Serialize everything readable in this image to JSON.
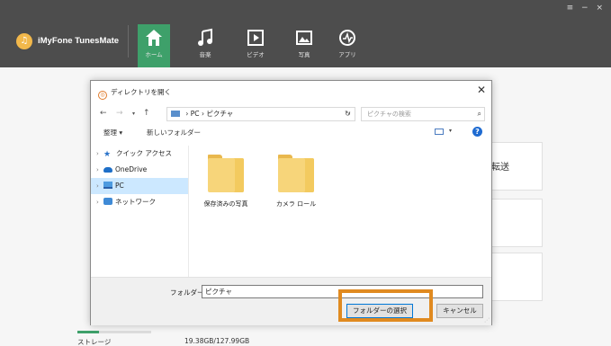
{
  "window_controls": "≡ − ×",
  "app": {
    "name": "iMyFone TunesMate"
  },
  "nav": [
    {
      "label": "ホーム",
      "icon": "home-icon",
      "active": true
    },
    {
      "label": "音楽",
      "icon": "music-icon",
      "active": false
    },
    {
      "label": "ビデオ",
      "icon": "video-icon",
      "active": false
    },
    {
      "label": "写真",
      "icon": "photo-icon",
      "active": false
    },
    {
      "label": "アプリ",
      "icon": "app-icon",
      "active": false
    }
  ],
  "background_card_text": "転送",
  "storage": {
    "label": "ストレージ",
    "value": "19.38GB/127.99GB",
    "used_fraction": 0.15
  },
  "dialog": {
    "title": "ディレクトリを開く",
    "address": [
      "PC",
      "ピクチャ"
    ],
    "search_placeholder": "ピクチャの検索",
    "organize": "整理 ▾",
    "new_folder": "新しいフォルダー",
    "tree": [
      {
        "label": "クイック アクセス",
        "icon": "star-icon"
      },
      {
        "label": "OneDrive",
        "icon": "cloud-icon"
      },
      {
        "label": "PC",
        "icon": "pc-icon",
        "selected": true
      },
      {
        "label": "ネットワーク",
        "icon": "network-icon"
      }
    ],
    "folders": [
      {
        "name": "保存済みの写真"
      },
      {
        "name": "カメラ ロール"
      }
    ],
    "folder_label": "フォルダー:",
    "folder_value": "ピクチャ",
    "select_button": "フォルダーの選択",
    "cancel_button": "キャンセル"
  },
  "colors": {
    "topbar": "#4d4d4d",
    "accent": "#3ea06a",
    "highlight": "#e08a20"
  }
}
